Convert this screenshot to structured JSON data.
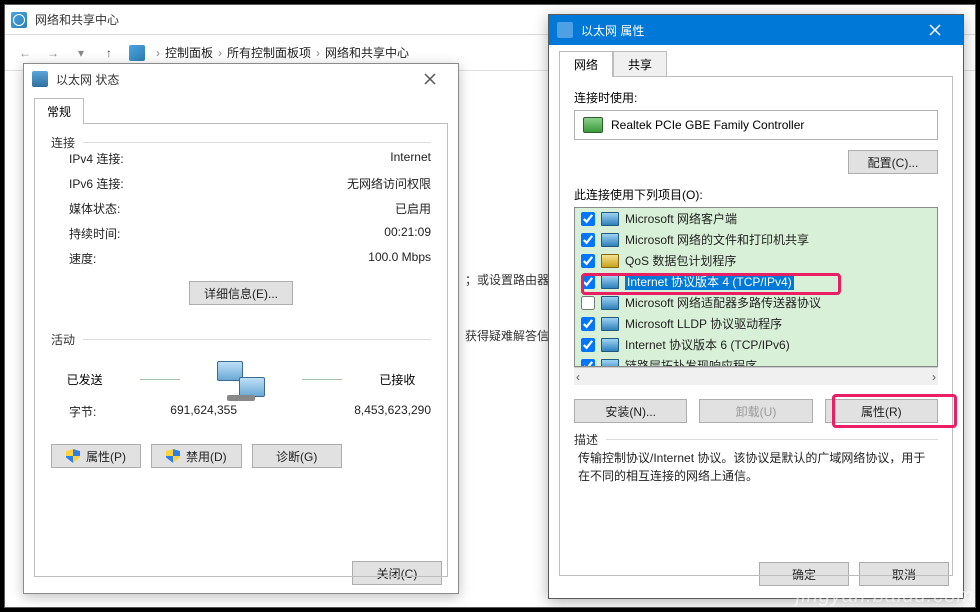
{
  "main": {
    "title": "网络和共享中心",
    "breadcrumb": [
      "控制面板",
      "所有控制面板项",
      "网络和共享中心"
    ],
    "body_text1": "；或设置路由器或接入",
    "body_text2": "获得疑难解答信息。"
  },
  "status": {
    "title": "以太网 状态",
    "tab": "常规",
    "conn_legend": "连接",
    "rows": [
      {
        "k": "IPv4 连接:",
        "v": "Internet"
      },
      {
        "k": "IPv6 连接:",
        "v": "无网络访问权限"
      },
      {
        "k": "媒体状态:",
        "v": "已启用"
      },
      {
        "k": "持续时间:",
        "v": "00:21:09"
      },
      {
        "k": "速度:",
        "v": "100.0 Mbps"
      }
    ],
    "details_btn": "详细信息(E)...",
    "activity_legend": "活动",
    "sent": "已发送",
    "recv": "已接收",
    "bytes_label": "字节:",
    "bytes_sent": "691,624,355",
    "bytes_recv": "8,453,623,290",
    "props_btn": "属性(P)",
    "disable_btn": "禁用(D)",
    "diag_btn": "诊断(G)",
    "close_btn": "关闭(C)"
  },
  "props": {
    "title": "以太网 属性",
    "tabs": [
      "网络",
      "共享"
    ],
    "connect_using": "连接时使用:",
    "adapter": "Realtek PCIe GBE Family Controller",
    "configure_btn": "配置(C)...",
    "items_label": "此连接使用下列项目(O):",
    "items": [
      {
        "c": true,
        "icon": "b",
        "t": "Microsoft 网络客户端"
      },
      {
        "c": true,
        "icon": "b",
        "t": "Microsoft 网络的文件和打印机共享"
      },
      {
        "c": true,
        "icon": "y",
        "t": "QoS 数据包计划程序"
      },
      {
        "c": true,
        "icon": "b",
        "t": "Internet 协议版本 4 (TCP/IPv4)",
        "sel": true
      },
      {
        "c": false,
        "icon": "b",
        "t": "Microsoft 网络适配器多路传送器协议"
      },
      {
        "c": true,
        "icon": "b",
        "t": "Microsoft LLDP 协议驱动程序"
      },
      {
        "c": true,
        "icon": "b",
        "t": "Internet 协议版本 6 (TCP/IPv6)"
      },
      {
        "c": true,
        "icon": "b",
        "t": "链路层拓扑发现响应程序"
      }
    ],
    "install_btn": "安装(N)...",
    "uninstall_btn": "卸载(U)",
    "props_btn": "属性(R)",
    "desc_legend": "描述",
    "desc_text": "传输控制协议/Internet 协议。该协议是默认的广域网络协议，用于在不同的相互连接的网络上通信。",
    "ok_btn": "确定",
    "cancel_btn": "取消"
  },
  "watermark": "jingyan.baidu.com"
}
